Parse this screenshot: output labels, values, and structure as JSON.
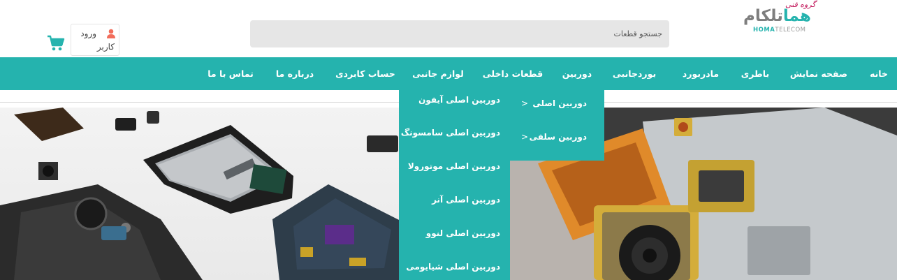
{
  "header": {
    "logo": {
      "script": "گروه فنی",
      "main_a": "هما",
      "main_b": "تلکام",
      "sub_a": "HOMA",
      "sub_b": "TELECOM"
    },
    "search": {
      "placeholder": "جستجو قطعات",
      "icon": "search-icon"
    },
    "login": {
      "line1": "ورود",
      "line2": "کاربر",
      "icon": "user-icon"
    },
    "cart": {
      "icon": "cart-icon"
    },
    "colors": {
      "brand": "#25b3ae",
      "login_icon": "#f26d5b",
      "logo_gray": "#7e7e7e"
    }
  },
  "nav": {
    "items": [
      {
        "label": "خانه"
      },
      {
        "label": "صفحه نمایش"
      },
      {
        "label": "باطری"
      },
      {
        "label": "مادربورد"
      },
      {
        "label": "بوردجانبی"
      },
      {
        "label": "دوربین"
      },
      {
        "label": "قطعات داخلی"
      },
      {
        "label": "لوازم جانبی"
      },
      {
        "label": "حساب کابردی"
      },
      {
        "label": "درباره ما"
      },
      {
        "label": "تماس با ما"
      }
    ]
  },
  "dropdown": {
    "items": [
      {
        "label": "دوربین اصلی آیفون"
      },
      {
        "label": "دوربین اصلی سامسونگ"
      },
      {
        "label": "دوربین اصلی موتورولا"
      },
      {
        "label": "دوربین اصلی آنر"
      },
      {
        "label": "دوربین اصلی لنوو"
      },
      {
        "label": "دوربین اصلی شیایومی"
      }
    ]
  },
  "flyout": {
    "items": [
      {
        "label": "دوربین اصلی",
        "arrow": ">"
      },
      {
        "label": "دوربین سلفی",
        "arrow": ">"
      }
    ]
  }
}
